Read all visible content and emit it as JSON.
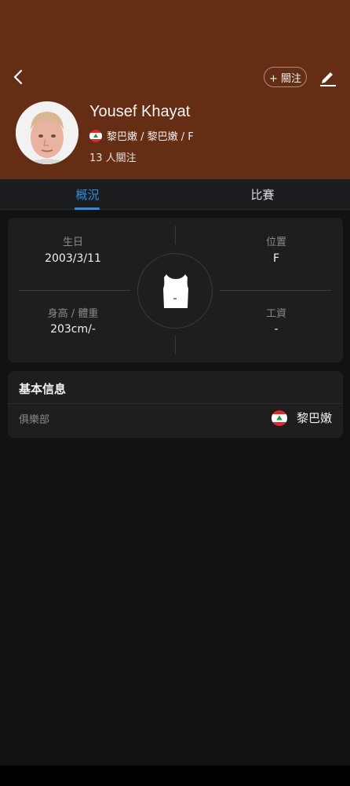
{
  "header": {
    "follow_label": "+ 關注",
    "player_name": "Yousef Khayat",
    "team_line": "黎巴嫩 / 黎巴嫩 / F",
    "followers": "13 人關注"
  },
  "tabs": [
    {
      "label": "概況",
      "active": true
    },
    {
      "label": "比賽",
      "active": false
    }
  ],
  "stats": {
    "birthday_label": "生日",
    "birthday_value": "2003/3/11",
    "position_label": "位置",
    "position_value": "F",
    "height_weight_label": "身高 / 體重",
    "height_weight_value": "203cm/-",
    "salary_label": "工資",
    "salary_value": "-"
  },
  "basic_info": {
    "title": "基本信息",
    "club_label": "俱樂部",
    "club_value": "黎巴嫩"
  },
  "colors": {
    "header_bg": "#652d14",
    "accent": "#2f8ce0",
    "card_bg": "#1e1e1e",
    "page_bg": "#121212"
  },
  "icons": [
    "back-arrow-icon",
    "edit-pencil-icon",
    "lebanon-flag-icon",
    "jersey-icon"
  ]
}
